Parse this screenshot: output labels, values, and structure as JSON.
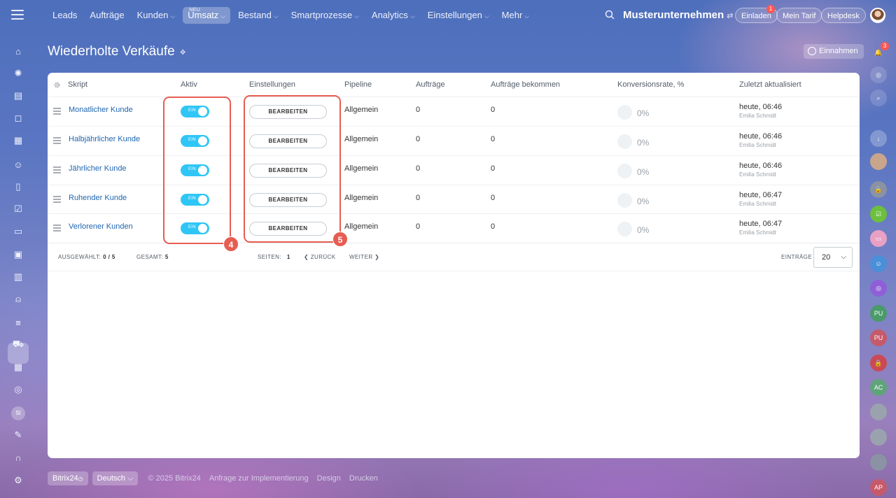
{
  "topbar": {
    "menu": [
      {
        "label": "Leads",
        "caret": false
      },
      {
        "label": "Aufträge",
        "caret": false
      },
      {
        "label": "Kunden",
        "caret": true
      },
      {
        "label": "Umsatz",
        "caret": true,
        "active": true,
        "badge": "NEU"
      },
      {
        "label": "Bestand",
        "caret": true
      },
      {
        "label": "Smartprozesse",
        "caret": true
      },
      {
        "label": "Analytics",
        "caret": true
      },
      {
        "label": "Einstellungen",
        "caret": true
      },
      {
        "label": "Mehr",
        "caret": true
      }
    ],
    "company": "Musterunternehmen",
    "invite_label": "Einladen",
    "invite_badge": "1",
    "tariff_label": "Mein Tarif",
    "helpdesk_label": "Helpdesk",
    "notification_badge": "3"
  },
  "page": {
    "title": "Wiederholte Verkäufe",
    "income_button": "Einnahmen"
  },
  "table": {
    "columns": [
      "Skript",
      "Aktiv",
      "Einstellungen",
      "Pipeline",
      "Aufträge",
      "Aufträge bekommen",
      "Konversionsrate, %",
      "Zuletzt aktualisiert"
    ],
    "toggle_label": "EIN",
    "edit_label": "BEARBEITEN",
    "rows": [
      {
        "name": "Monatlicher Kunde",
        "pipeline": "Allgemein",
        "orders": "0",
        "orders_received": "0",
        "conversion": "0%",
        "updated": "heute, 06:46",
        "user": "Emilia Schmidt"
      },
      {
        "name": "Halbjährlicher Kunde",
        "pipeline": "Allgemein",
        "orders": "0",
        "orders_received": "0",
        "conversion": "0%",
        "updated": "heute, 06:46",
        "user": "Emilia Schmidt"
      },
      {
        "name": "Jährlicher Kunde",
        "pipeline": "Allgemein",
        "orders": "0",
        "orders_received": "0",
        "conversion": "0%",
        "updated": "heute, 06:46",
        "user": "Emilia Schmidt"
      },
      {
        "name": "Ruhender Kunde",
        "pipeline": "Allgemein",
        "orders": "0",
        "orders_received": "0",
        "conversion": "0%",
        "updated": "heute, 06:47",
        "user": "Emilia Schmidt"
      },
      {
        "name": "Verlorener Kunden",
        "pipeline": "Allgemein",
        "orders": "0",
        "orders_received": "0",
        "conversion": "0%",
        "updated": "heute, 06:47",
        "user": "Emilia Schmidt"
      }
    ]
  },
  "annotations": {
    "badge_4": "4",
    "badge_5": "5"
  },
  "footer": {
    "selected_label": "Ausgewählt:",
    "selected_value": "0 / 5",
    "total_label": "Gesamt:",
    "total_value": "5",
    "pages_label": "Seiten:",
    "pages_value": "1",
    "back_label": "ZURÜCK",
    "next_label": "WEITER",
    "entries_label": "Einträge",
    "entries_value": "20"
  },
  "bottombar": {
    "brand": "Bitrix24",
    "language": "Deutsch",
    "copyright": "© 2025 Bitrix24",
    "links": [
      "Anfrage zur Implementierung",
      "Design",
      "Drucken"
    ]
  },
  "rightbar_avatars": [
    "PU",
    "PU",
    "AC",
    "AP"
  ],
  "leftbar_initials": "SI",
  "colors": {
    "accent": "#2fc6f6",
    "link": "#2067b0",
    "highlight": "#e65d52"
  }
}
